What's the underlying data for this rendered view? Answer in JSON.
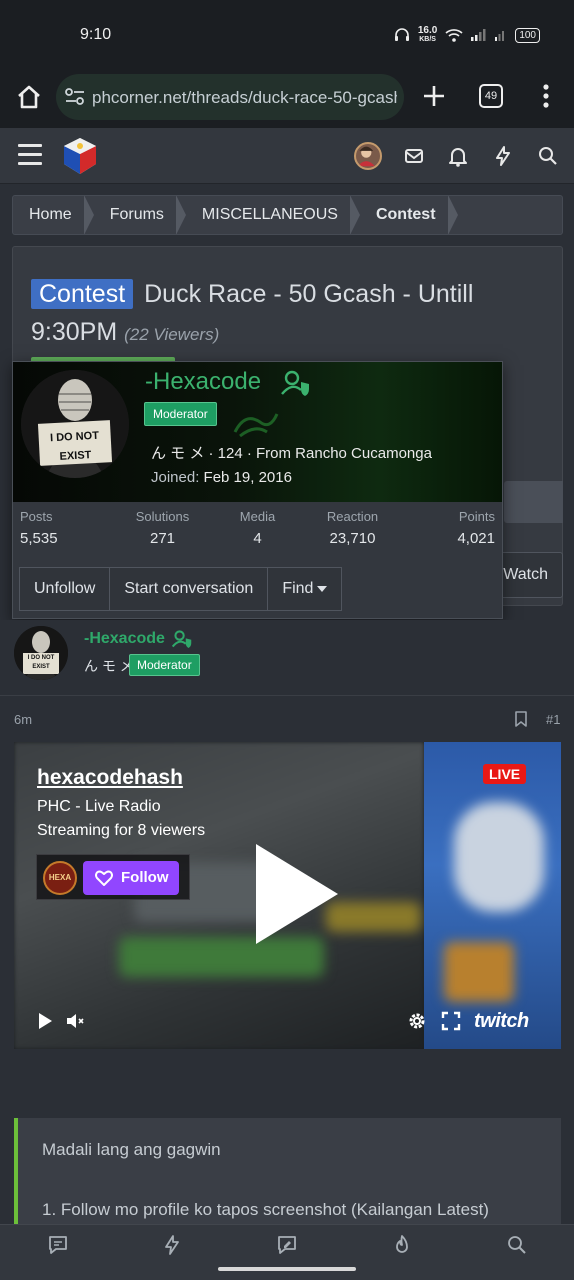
{
  "status": {
    "time": "9:10",
    "speed": "16.0",
    "speed_unit": "KB/S",
    "battery": "100"
  },
  "browser": {
    "url": "phcorner.net/threads/duck-race-50-gcash-ur",
    "tab_count": "49"
  },
  "breadcrumb": [
    "Home",
    "Forums",
    "MISCELLANEOUS",
    "Contest"
  ],
  "thread": {
    "prefix": "Contest",
    "title": "Duck Race - 50 Gcash - Untill 9:30PM",
    "viewers": "(22 Viewers)",
    "watch_label": "Watch"
  },
  "member_card": {
    "name": "-Hexacode",
    "badge": "Moderator",
    "blurb": "ん モ メ · 124 · From Rancho Cucamonga",
    "joined_label": "Joined:",
    "joined_value": "Feb 19, 2016",
    "avatar_sign": "I DO NOT EXIST",
    "stats": [
      {
        "label": "Posts",
        "value": "5,535"
      },
      {
        "label": "Solutions",
        "value": "271"
      },
      {
        "label": "Media",
        "value": "4"
      },
      {
        "label": "Reaction",
        "value": "23,710"
      },
      {
        "label": "Points",
        "value": "4,021"
      }
    ],
    "actions": {
      "unfollow": "Unfollow",
      "start": "Start conversation",
      "find": "Find"
    }
  },
  "post": {
    "author": "-Hexacode",
    "blurb": "ん モ メ",
    "badge": "Moderator",
    "time": "6m",
    "number": "#1"
  },
  "embed": {
    "channel": "hexacodehash",
    "title": "PHC - Live Radio",
    "streaming": "Streaming for 8 viewers",
    "logo_text": "HEXA",
    "follow": "Follow",
    "live": "LIVE",
    "brand": "twitch"
  },
  "body": {
    "line1": "Madali lang ang gagwin",
    "line2": "1. Follow mo profile ko tapos screenshot (Kailangan Latest)"
  },
  "colors": {
    "accent_green": "#2fa86a",
    "contest_blue": "#3f6fc4",
    "twitch_purple": "#9146ff",
    "live_red": "#e91916"
  }
}
